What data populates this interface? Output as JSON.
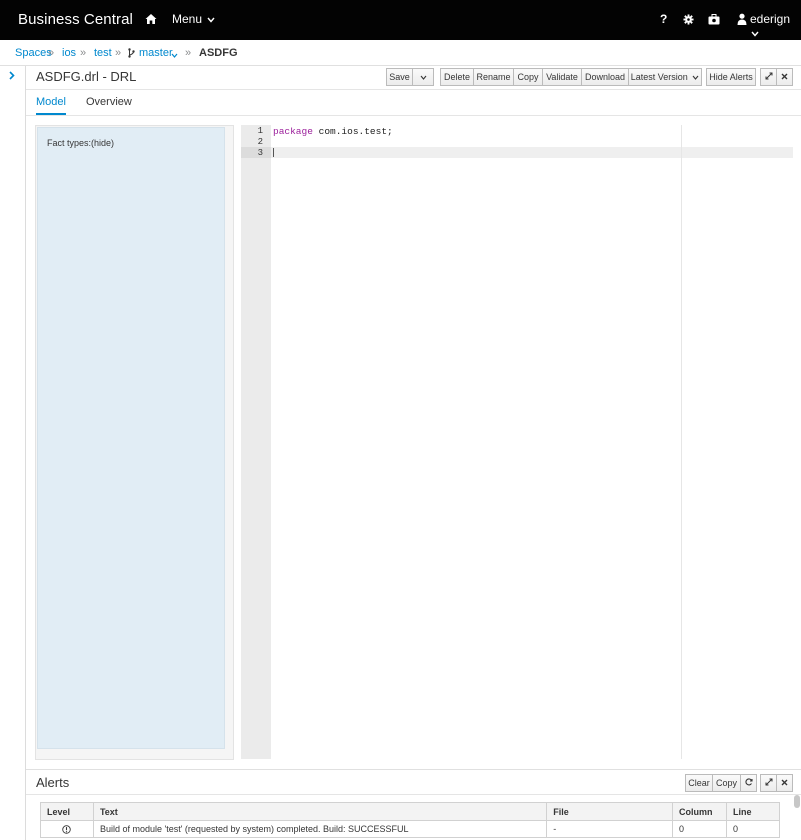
{
  "navbar": {
    "brand": "Business Central",
    "menu_label": "Menu",
    "help_label": "?",
    "user_name": "ederign"
  },
  "breadcrumb": {
    "items": [
      "Spaces",
      "ios",
      "test",
      "master"
    ],
    "separator": "»",
    "active": "ASDFG"
  },
  "editor": {
    "title": "ASDFG.drl - DRL",
    "toolbar": {
      "save": "Save",
      "delete": "Delete",
      "rename": "Rename",
      "copy": "Copy",
      "validate": "Validate",
      "download": "Download",
      "latest_version": "Latest Version",
      "hide_alerts": "Hide Alerts"
    },
    "tabs": [
      "Model",
      "Overview"
    ],
    "fact_types_label": "Fact types:",
    "fact_types_toggle": "(hide)",
    "code": {
      "line_numbers": [
        "1",
        "2",
        "3"
      ],
      "line1_keyword": "package",
      "line1_rest": " com.ios.test;"
    }
  },
  "alerts": {
    "title": "Alerts",
    "clear_label": "Clear",
    "copy_label": "Copy",
    "columns": [
      "Level",
      "Text",
      "File",
      "Column",
      "Line"
    ],
    "rows": [
      {
        "level_icon": "info-circle-icon",
        "text": "Build of module 'test' (requested by system) completed. Build: SUCCESSFUL",
        "file": "-",
        "column": "0",
        "line": "0"
      }
    ]
  },
  "colors": {
    "navbar_bg": "#030303",
    "link": "#0088ce",
    "fact_panel_bg": "#e1edf5",
    "keyword": "#9b1f9b"
  }
}
